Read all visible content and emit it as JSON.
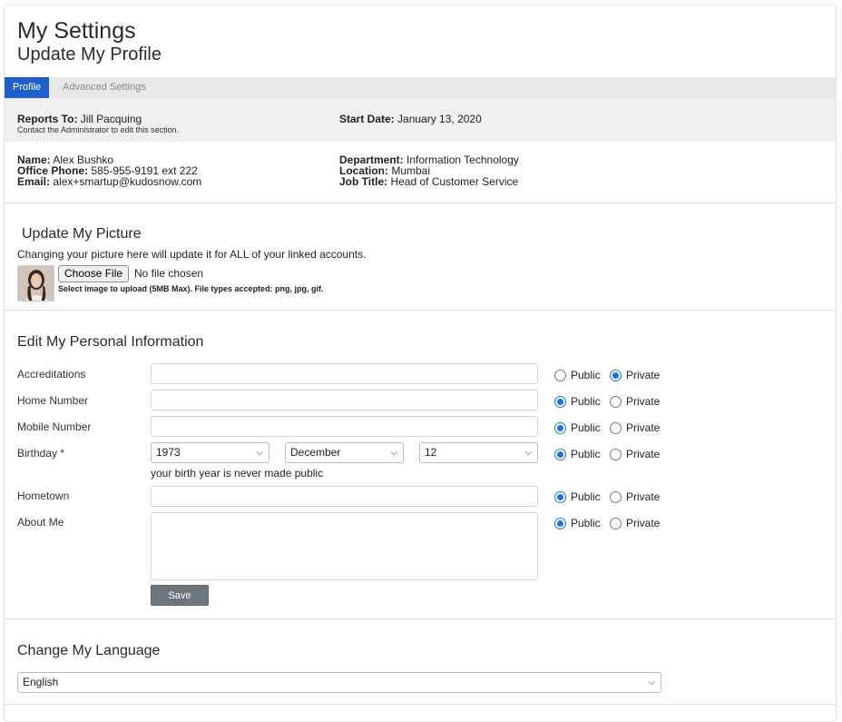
{
  "header": {
    "title": "My Settings",
    "subtitle": "Update My Profile"
  },
  "tabs": [
    {
      "label": "Profile",
      "active": true
    },
    {
      "label": "Advanced Settings",
      "active": false
    }
  ],
  "reports": {
    "reports_to_label": "Reports To:",
    "reports_to_value": "Jill Pacquing",
    "note": "Contact the Administrator to edit this section.",
    "start_date_label": "Start Date:",
    "start_date_value": "January 13, 2020"
  },
  "info": {
    "name_label": "Name:",
    "name_value": "Alex Bushko",
    "phone_label": "Office Phone:",
    "phone_value": "585-955-9191 ext 222",
    "email_label": "Email:",
    "email_value": "alex+smartup@kudosnow.com",
    "dept_label": "Department:",
    "dept_value": "Information Technology",
    "location_label": "Location:",
    "location_value": "Mumbai",
    "job_label": "Job Title:",
    "job_value": "Head of Customer Service"
  },
  "picture": {
    "title": "Update My Picture",
    "description": "Changing your picture here will update it for ALL of your linked accounts.",
    "choose_label": "Choose File",
    "no_file": "No file chosen",
    "hint": "Select image to upload (5MB Max). File types accepted: png, jpg, gif."
  },
  "personal": {
    "title": "Edit My Personal Information",
    "public_label": "Public",
    "private_label": "Private",
    "fields": [
      {
        "label": "Accreditations",
        "value": "",
        "visibility": "private"
      },
      {
        "label": "Home Number",
        "value": "",
        "visibility": "public"
      },
      {
        "label": "Mobile Number",
        "value": "",
        "visibility": "public"
      },
      {
        "label": "Birthday *",
        "visibility": "public"
      },
      {
        "label": "Hometown",
        "value": "",
        "visibility": "public"
      },
      {
        "label": "About Me",
        "value": "",
        "visibility": "public"
      }
    ],
    "birthday": {
      "year": "1973",
      "month": "December",
      "day": "12"
    },
    "birth_note": "your birth year is never made public",
    "save_label": "Save"
  },
  "language": {
    "title": "Change My Language",
    "selected": "English"
  },
  "colors": {
    "accent": "#1f5fcc",
    "radio": "#1a73e8",
    "save_button": "#6d757d"
  }
}
